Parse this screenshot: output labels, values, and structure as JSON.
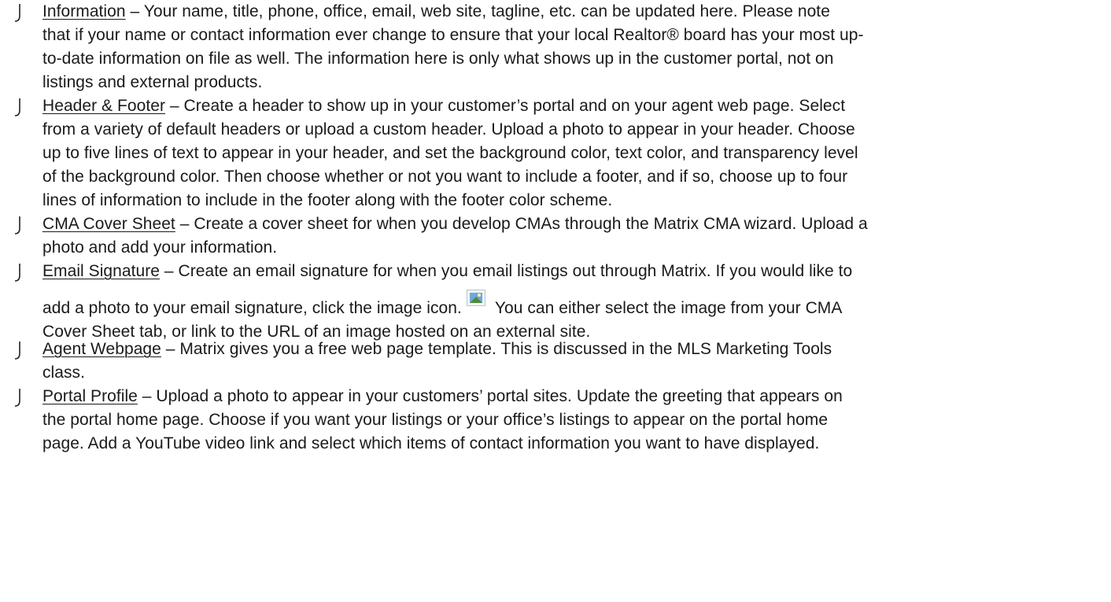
{
  "items": [
    {
      "term": "Information",
      "lines": [
        " – Your name, title, phone, office, email, web site, tagline, etc. can be updated here.  Please note",
        "that if your name or contact information ever change to ensure that your local Realtor® board has your most up-",
        "to-date information on file as well. The information here is only what shows up in the customer portal, not on",
        "listings and external products."
      ]
    },
    {
      "term": "Header & Footer",
      "lines": [
        " – Create a header to show up in your customer’s portal and on your agent web page.  Select",
        "from a variety of default headers or upload a custom header.  Upload a photo to appear in your header.  Choose",
        "up to five lines of text to appear in your header, and set the background color, text color, and transparency level",
        "of the background color.  Then choose whether or not you want to include a footer, and if so, choose up to four",
        "lines of information to include in the footer along with the footer color scheme."
      ]
    },
    {
      "term": "CMA Cover Sheet",
      "lines": [
        " – Create a cover sheet for when you develop CMAs through the Matrix CMA wizard. Upload a",
        "photo and add your information."
      ]
    },
    {
      "term": "Email Signature",
      "lines": [
        " – Create an email signature for when you email listings out through Matrix.  If you would like to",
        "add a photo to your email signature, click the image icon.",
        "You can either select the image from your CMA",
        "Cover Sheet tab, or link to the URL of an image hosted on an external site."
      ],
      "icon": "image-icon"
    },
    {
      "term": "Agent Webpage",
      "lines": [
        " – Matrix gives you a free web page template.  This is discussed in the MLS Marketing Tools",
        "class."
      ]
    },
    {
      "term": "Portal Profile",
      "lines": [
        " – Upload a photo to appear in your customers’ portal sites.  Update the greeting that appears on",
        "the portal home page. Choose if you want your listings or your office’s listings to appear on the portal home",
        "page.  Add a YouTube video link and select which items of contact information you want to have displayed."
      ]
    }
  ],
  "bullet_icon": "bullet-hook-icon"
}
